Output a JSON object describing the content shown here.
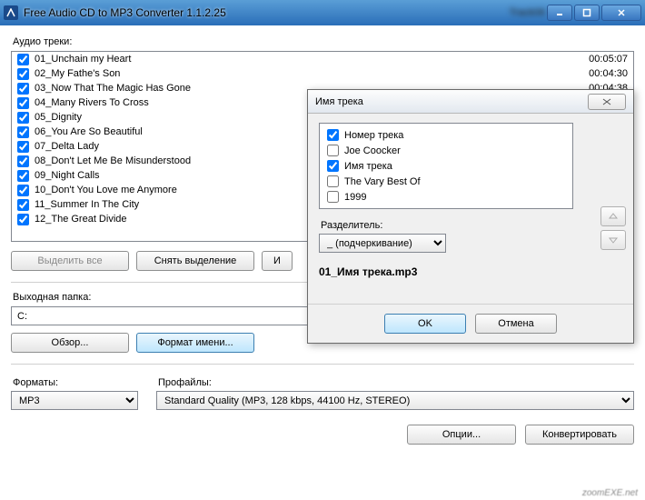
{
  "titlebar": {
    "title": "Free Audio CD to MP3 Converter 1.1.2.25",
    "blur_extra": "Track06"
  },
  "labels": {
    "audio_tracks": "Аудио треки:",
    "select_all": "Выделить все",
    "deselect": "Снять выделение",
    "output_folder": "Выходная папка:",
    "browse": "Обзор...",
    "name_format": "Формат имени...",
    "formats": "Форматы:",
    "profiles": "Профайлы:",
    "options": "Опции...",
    "convert": "Конвертировать"
  },
  "output_path": "C:",
  "format_selected": "MP3",
  "profile_selected": "Standard Quality (MP3, 128 kbps, 44100 Hz, STEREO)",
  "tracks": [
    {
      "name": "01_Unchain my Heart",
      "duration": "00:05:07",
      "checked": true
    },
    {
      "name": "02_My Fathe's Son",
      "duration": "00:04:30",
      "checked": true
    },
    {
      "name": "03_Now That The Magic Has Gone",
      "duration": "00:04:38",
      "checked": true
    },
    {
      "name": "04_Many Rivers To Cross",
      "duration": "",
      "checked": true,
      "blur": true
    },
    {
      "name": "05_Dignity",
      "duration": "",
      "checked": true,
      "blur": true
    },
    {
      "name": "06_You Are So Beautiful",
      "duration": "",
      "checked": true
    },
    {
      "name": "07_Delta Lady",
      "duration": "",
      "checked": true
    },
    {
      "name": "08_Don't Let Me Be Misunderstood",
      "duration": "",
      "checked": true
    },
    {
      "name": "09_Night Calls",
      "duration": "",
      "checked": true
    },
    {
      "name": "10_Don't You Love me Anymore",
      "duration": "",
      "checked": true
    },
    {
      "name": "11_Summer In The City",
      "duration": "",
      "checked": true
    },
    {
      "name": "12_The Great Divide",
      "duration": "",
      "checked": true
    }
  ],
  "dialog": {
    "title": "Имя трека",
    "options": [
      {
        "label": "Номер трека",
        "checked": true
      },
      {
        "label": "Joe Coocker",
        "checked": false
      },
      {
        "label": "Имя трека",
        "checked": true
      },
      {
        "label": "The Vary Best Of",
        "checked": false
      },
      {
        "label": "1999",
        "checked": false
      }
    ],
    "separator_label": "Разделитель:",
    "separator_value": "_ (подчеркивание)",
    "preview": "01_Имя трека.mp3",
    "ok": "OK",
    "cancel": "Отмена"
  },
  "watermark": "zoomEXE.net"
}
